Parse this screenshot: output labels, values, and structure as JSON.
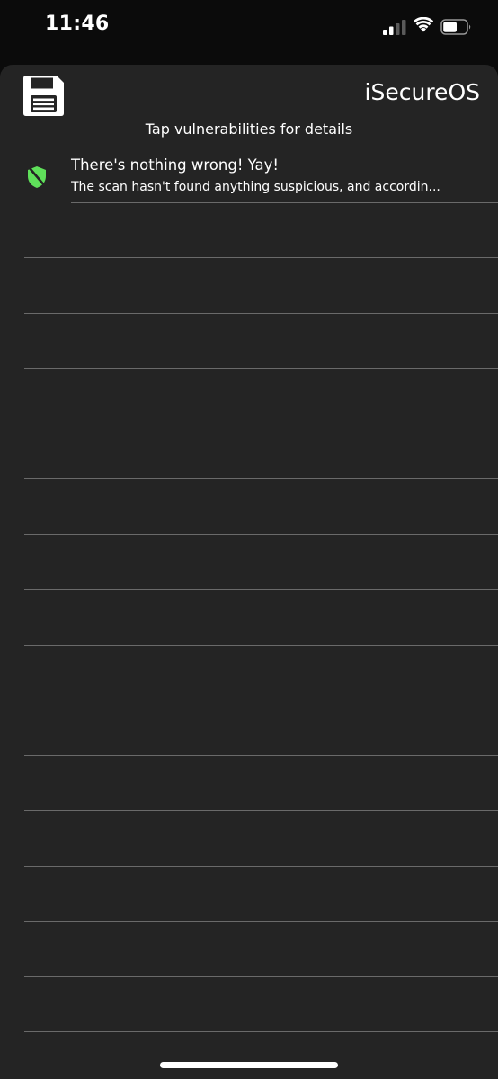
{
  "status_bar": {
    "time": "11:46",
    "signal_icon": "cellular-signal-icon",
    "wifi_icon": "wifi-icon",
    "battery_icon": "battery-icon",
    "battery_level": 0.6
  },
  "header": {
    "save_icon": "floppy-disk-icon",
    "title": "iSecureOS",
    "subtitle": "Tap vulnerabilities for details"
  },
  "vulnerabilities": [
    {
      "icon": "shield-check-icon",
      "icon_color": "#5fe05a",
      "title": "There's nothing wrong! Yay!",
      "detail": "The scan hasn't found anything suspicious, and accordin..."
    }
  ],
  "colors": {
    "background": "#0b0b0b",
    "sheet": "#242424",
    "separator": "#6a6a6a",
    "text": "#ffffff",
    "accent_green": "#5fe05a"
  }
}
